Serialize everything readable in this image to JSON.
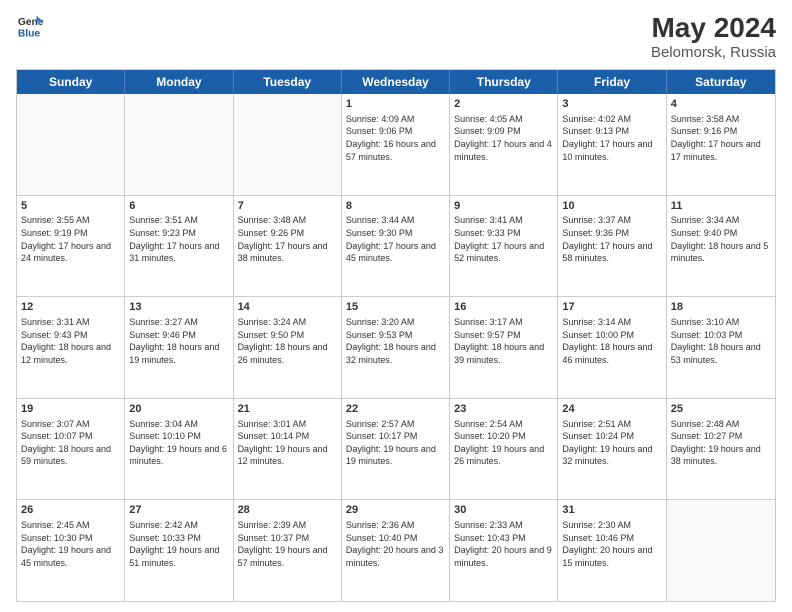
{
  "header": {
    "logo_line1": "General",
    "logo_line2": "Blue",
    "month": "May 2024",
    "location": "Belomorsk, Russia"
  },
  "weekdays": [
    "Sunday",
    "Monday",
    "Tuesday",
    "Wednesday",
    "Thursday",
    "Friday",
    "Saturday"
  ],
  "rows": [
    [
      {
        "day": "",
        "sunrise": "",
        "sunset": "",
        "daylight": ""
      },
      {
        "day": "",
        "sunrise": "",
        "sunset": "",
        "daylight": ""
      },
      {
        "day": "",
        "sunrise": "",
        "sunset": "",
        "daylight": ""
      },
      {
        "day": "1",
        "sunrise": "Sunrise: 4:09 AM",
        "sunset": "Sunset: 9:06 PM",
        "daylight": "Daylight: 16 hours and 57 minutes."
      },
      {
        "day": "2",
        "sunrise": "Sunrise: 4:05 AM",
        "sunset": "Sunset: 9:09 PM",
        "daylight": "Daylight: 17 hours and 4 minutes."
      },
      {
        "day": "3",
        "sunrise": "Sunrise: 4:02 AM",
        "sunset": "Sunset: 9:13 PM",
        "daylight": "Daylight: 17 hours and 10 minutes."
      },
      {
        "day": "4",
        "sunrise": "Sunrise: 3:58 AM",
        "sunset": "Sunset: 9:16 PM",
        "daylight": "Daylight: 17 hours and 17 minutes."
      }
    ],
    [
      {
        "day": "5",
        "sunrise": "Sunrise: 3:55 AM",
        "sunset": "Sunset: 9:19 PM",
        "daylight": "Daylight: 17 hours and 24 minutes."
      },
      {
        "day": "6",
        "sunrise": "Sunrise: 3:51 AM",
        "sunset": "Sunset: 9:23 PM",
        "daylight": "Daylight: 17 hours and 31 minutes."
      },
      {
        "day": "7",
        "sunrise": "Sunrise: 3:48 AM",
        "sunset": "Sunset: 9:26 PM",
        "daylight": "Daylight: 17 hours and 38 minutes."
      },
      {
        "day": "8",
        "sunrise": "Sunrise: 3:44 AM",
        "sunset": "Sunset: 9:30 PM",
        "daylight": "Daylight: 17 hours and 45 minutes."
      },
      {
        "day": "9",
        "sunrise": "Sunrise: 3:41 AM",
        "sunset": "Sunset: 9:33 PM",
        "daylight": "Daylight: 17 hours and 52 minutes."
      },
      {
        "day": "10",
        "sunrise": "Sunrise: 3:37 AM",
        "sunset": "Sunset: 9:36 PM",
        "daylight": "Daylight: 17 hours and 58 minutes."
      },
      {
        "day": "11",
        "sunrise": "Sunrise: 3:34 AM",
        "sunset": "Sunset: 9:40 PM",
        "daylight": "Daylight: 18 hours and 5 minutes."
      }
    ],
    [
      {
        "day": "12",
        "sunrise": "Sunrise: 3:31 AM",
        "sunset": "Sunset: 9:43 PM",
        "daylight": "Daylight: 18 hours and 12 minutes."
      },
      {
        "day": "13",
        "sunrise": "Sunrise: 3:27 AM",
        "sunset": "Sunset: 9:46 PM",
        "daylight": "Daylight: 18 hours and 19 minutes."
      },
      {
        "day": "14",
        "sunrise": "Sunrise: 3:24 AM",
        "sunset": "Sunset: 9:50 PM",
        "daylight": "Daylight: 18 hours and 26 minutes."
      },
      {
        "day": "15",
        "sunrise": "Sunrise: 3:20 AM",
        "sunset": "Sunset: 9:53 PM",
        "daylight": "Daylight: 18 hours and 32 minutes."
      },
      {
        "day": "16",
        "sunrise": "Sunrise: 3:17 AM",
        "sunset": "Sunset: 9:57 PM",
        "daylight": "Daylight: 18 hours and 39 minutes."
      },
      {
        "day": "17",
        "sunrise": "Sunrise: 3:14 AM",
        "sunset": "Sunset: 10:00 PM",
        "daylight": "Daylight: 18 hours and 46 minutes."
      },
      {
        "day": "18",
        "sunrise": "Sunrise: 3:10 AM",
        "sunset": "Sunset: 10:03 PM",
        "daylight": "Daylight: 18 hours and 53 minutes."
      }
    ],
    [
      {
        "day": "19",
        "sunrise": "Sunrise: 3:07 AM",
        "sunset": "Sunset: 10:07 PM",
        "daylight": "Daylight: 18 hours and 59 minutes."
      },
      {
        "day": "20",
        "sunrise": "Sunrise: 3:04 AM",
        "sunset": "Sunset: 10:10 PM",
        "daylight": "Daylight: 19 hours and 6 minutes."
      },
      {
        "day": "21",
        "sunrise": "Sunrise: 3:01 AM",
        "sunset": "Sunset: 10:14 PM",
        "daylight": "Daylight: 19 hours and 12 minutes."
      },
      {
        "day": "22",
        "sunrise": "Sunrise: 2:57 AM",
        "sunset": "Sunset: 10:17 PM",
        "daylight": "Daylight: 19 hours and 19 minutes."
      },
      {
        "day": "23",
        "sunrise": "Sunrise: 2:54 AM",
        "sunset": "Sunset: 10:20 PM",
        "daylight": "Daylight: 19 hours and 26 minutes."
      },
      {
        "day": "24",
        "sunrise": "Sunrise: 2:51 AM",
        "sunset": "Sunset: 10:24 PM",
        "daylight": "Daylight: 19 hours and 32 minutes."
      },
      {
        "day": "25",
        "sunrise": "Sunrise: 2:48 AM",
        "sunset": "Sunset: 10:27 PM",
        "daylight": "Daylight: 19 hours and 38 minutes."
      }
    ],
    [
      {
        "day": "26",
        "sunrise": "Sunrise: 2:45 AM",
        "sunset": "Sunset: 10:30 PM",
        "daylight": "Daylight: 19 hours and 45 minutes."
      },
      {
        "day": "27",
        "sunrise": "Sunrise: 2:42 AM",
        "sunset": "Sunset: 10:33 PM",
        "daylight": "Daylight: 19 hours and 51 minutes."
      },
      {
        "day": "28",
        "sunrise": "Sunrise: 2:39 AM",
        "sunset": "Sunset: 10:37 PM",
        "daylight": "Daylight: 19 hours and 57 minutes."
      },
      {
        "day": "29",
        "sunrise": "Sunrise: 2:36 AM",
        "sunset": "Sunset: 10:40 PM",
        "daylight": "Daylight: 20 hours and 3 minutes."
      },
      {
        "day": "30",
        "sunrise": "Sunrise: 2:33 AM",
        "sunset": "Sunset: 10:43 PM",
        "daylight": "Daylight: 20 hours and 9 minutes."
      },
      {
        "day": "31",
        "sunrise": "Sunrise: 2:30 AM",
        "sunset": "Sunset: 10:46 PM",
        "daylight": "Daylight: 20 hours and 15 minutes."
      },
      {
        "day": "",
        "sunrise": "",
        "sunset": "",
        "daylight": ""
      }
    ]
  ]
}
